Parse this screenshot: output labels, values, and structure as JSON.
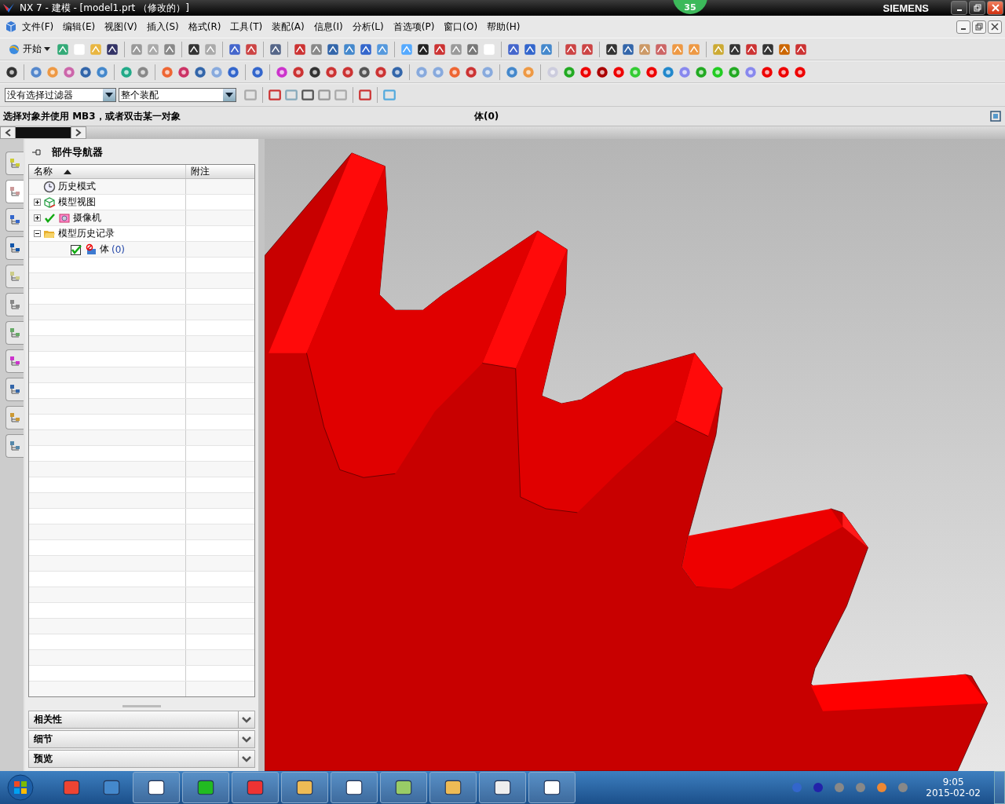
{
  "window": {
    "title": "NX 7 - 建模 - [model1.prt （修改的）]",
    "badge": "35",
    "brand": "SIEMENS"
  },
  "menu": [
    "文件(F)",
    "编辑(E)",
    "视图(V)",
    "插入(S)",
    "格式(R)",
    "工具(T)",
    "装配(A)",
    "信息(I)",
    "分析(L)",
    "首选项(P)",
    "窗口(O)",
    "帮助(H)"
  ],
  "toolbar": {
    "start_button": "开始"
  },
  "filter_bar": {
    "selection_filter": "没有选择过滤器",
    "scope": "整个装配"
  },
  "status_bar": {
    "prompt": "选择对象并使用 MB3，或者双击某一对象",
    "selection": "体(0)"
  },
  "navigator": {
    "title": "部件导航器",
    "columns": [
      {
        "label": "名称",
        "sorted": true
      },
      {
        "label": "附注",
        "sorted": false
      }
    ],
    "tree": [
      {
        "label": "历史模式",
        "kind": "clock"
      },
      {
        "label": "模型视图",
        "kind": "views",
        "expanded": false
      },
      {
        "label": "摄像机",
        "kind": "camera",
        "expanded": false,
        "checked": true
      },
      {
        "label": "模型历史记录",
        "kind": "folder",
        "expanded": true,
        "children": [
          {
            "label": "体",
            "count": "(0)",
            "kind": "body",
            "checked": true
          }
        ]
      }
    ],
    "panels": [
      {
        "label": "相关性",
        "expanded": false
      },
      {
        "label": "细节",
        "expanded": false
      },
      {
        "label": "预览",
        "expanded": false
      }
    ]
  },
  "resource_tabs": [
    {
      "selected": false
    },
    {
      "selected": true
    },
    {
      "selected": false
    },
    {
      "selected": false
    },
    {
      "selected": false
    },
    {
      "selected": false
    },
    {
      "selected": false
    },
    {
      "selected": false
    },
    {
      "selected": false
    },
    {
      "selected": false
    },
    {
      "selected": false
    }
  ],
  "taskbar": {
    "time": "9:05",
    "date": "2015-02-02"
  }
}
